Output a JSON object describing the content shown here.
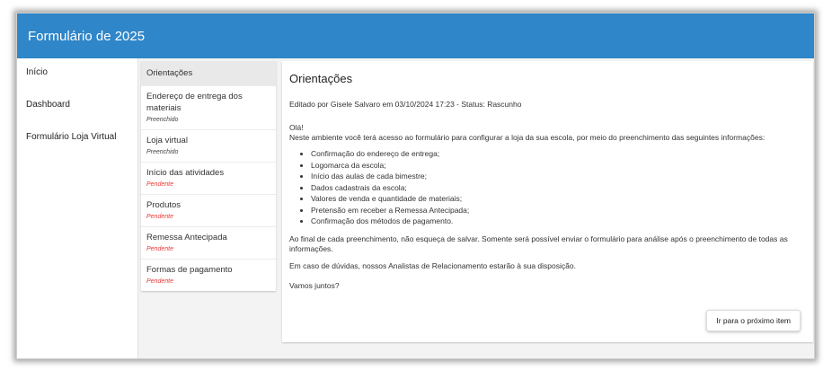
{
  "header": {
    "title": "Formulário de 2025"
  },
  "sidebar": {
    "items": [
      {
        "label": "Início"
      },
      {
        "label": "Dashboard"
      },
      {
        "label": "Formulário Loja Virtual"
      }
    ]
  },
  "steps": [
    {
      "label": "Orientações",
      "status": ""
    },
    {
      "label": "Endereço de entrega dos materiais",
      "status": "Preenchido"
    },
    {
      "label": "Loja virtual",
      "status": "Preenchido"
    },
    {
      "label": "Início das atividades",
      "status": "Pendente"
    },
    {
      "label": "Produtos",
      "status": "Pendente"
    },
    {
      "label": "Remessa Antecipada",
      "status": "Pendente"
    },
    {
      "label": "Formas de pagamento",
      "status": "Pendente"
    }
  ],
  "content": {
    "title": "Orientações",
    "meta": "Editado por Gisele Salvaro em 03/10/2024 17:23 - Status: Rascunho",
    "greeting": "Olá!",
    "intro": "Neste ambiente você terá acesso ao formulário para configurar a loja da sua escola, por meio do preenchimento das seguintes informações:",
    "items": [
      "Confirmação do endereço de entrega;",
      "Logomarca da escola;",
      "Início das aulas de cada bimestre;",
      "Dados cadastrais da escola;",
      "Valores de venda e quantidade de materiais;",
      "Pretensão em receber a Remessa Antecipada;",
      "Confirmação dos métodos de pagamento."
    ],
    "paragraph1": "Ao final de cada preenchimento, não esqueça de salvar. Somente será possível enviar o formulário para análise após o preenchimento de todas as informações.",
    "paragraph2": "Em caso de dúvidas, nossos Analistas de Relacionamento estarão à sua disposição.",
    "closing": "Vamos juntos?",
    "next_button": "Ir para o próximo item"
  },
  "colors": {
    "header": "#2f86c8",
    "pending": "#e53935"
  }
}
